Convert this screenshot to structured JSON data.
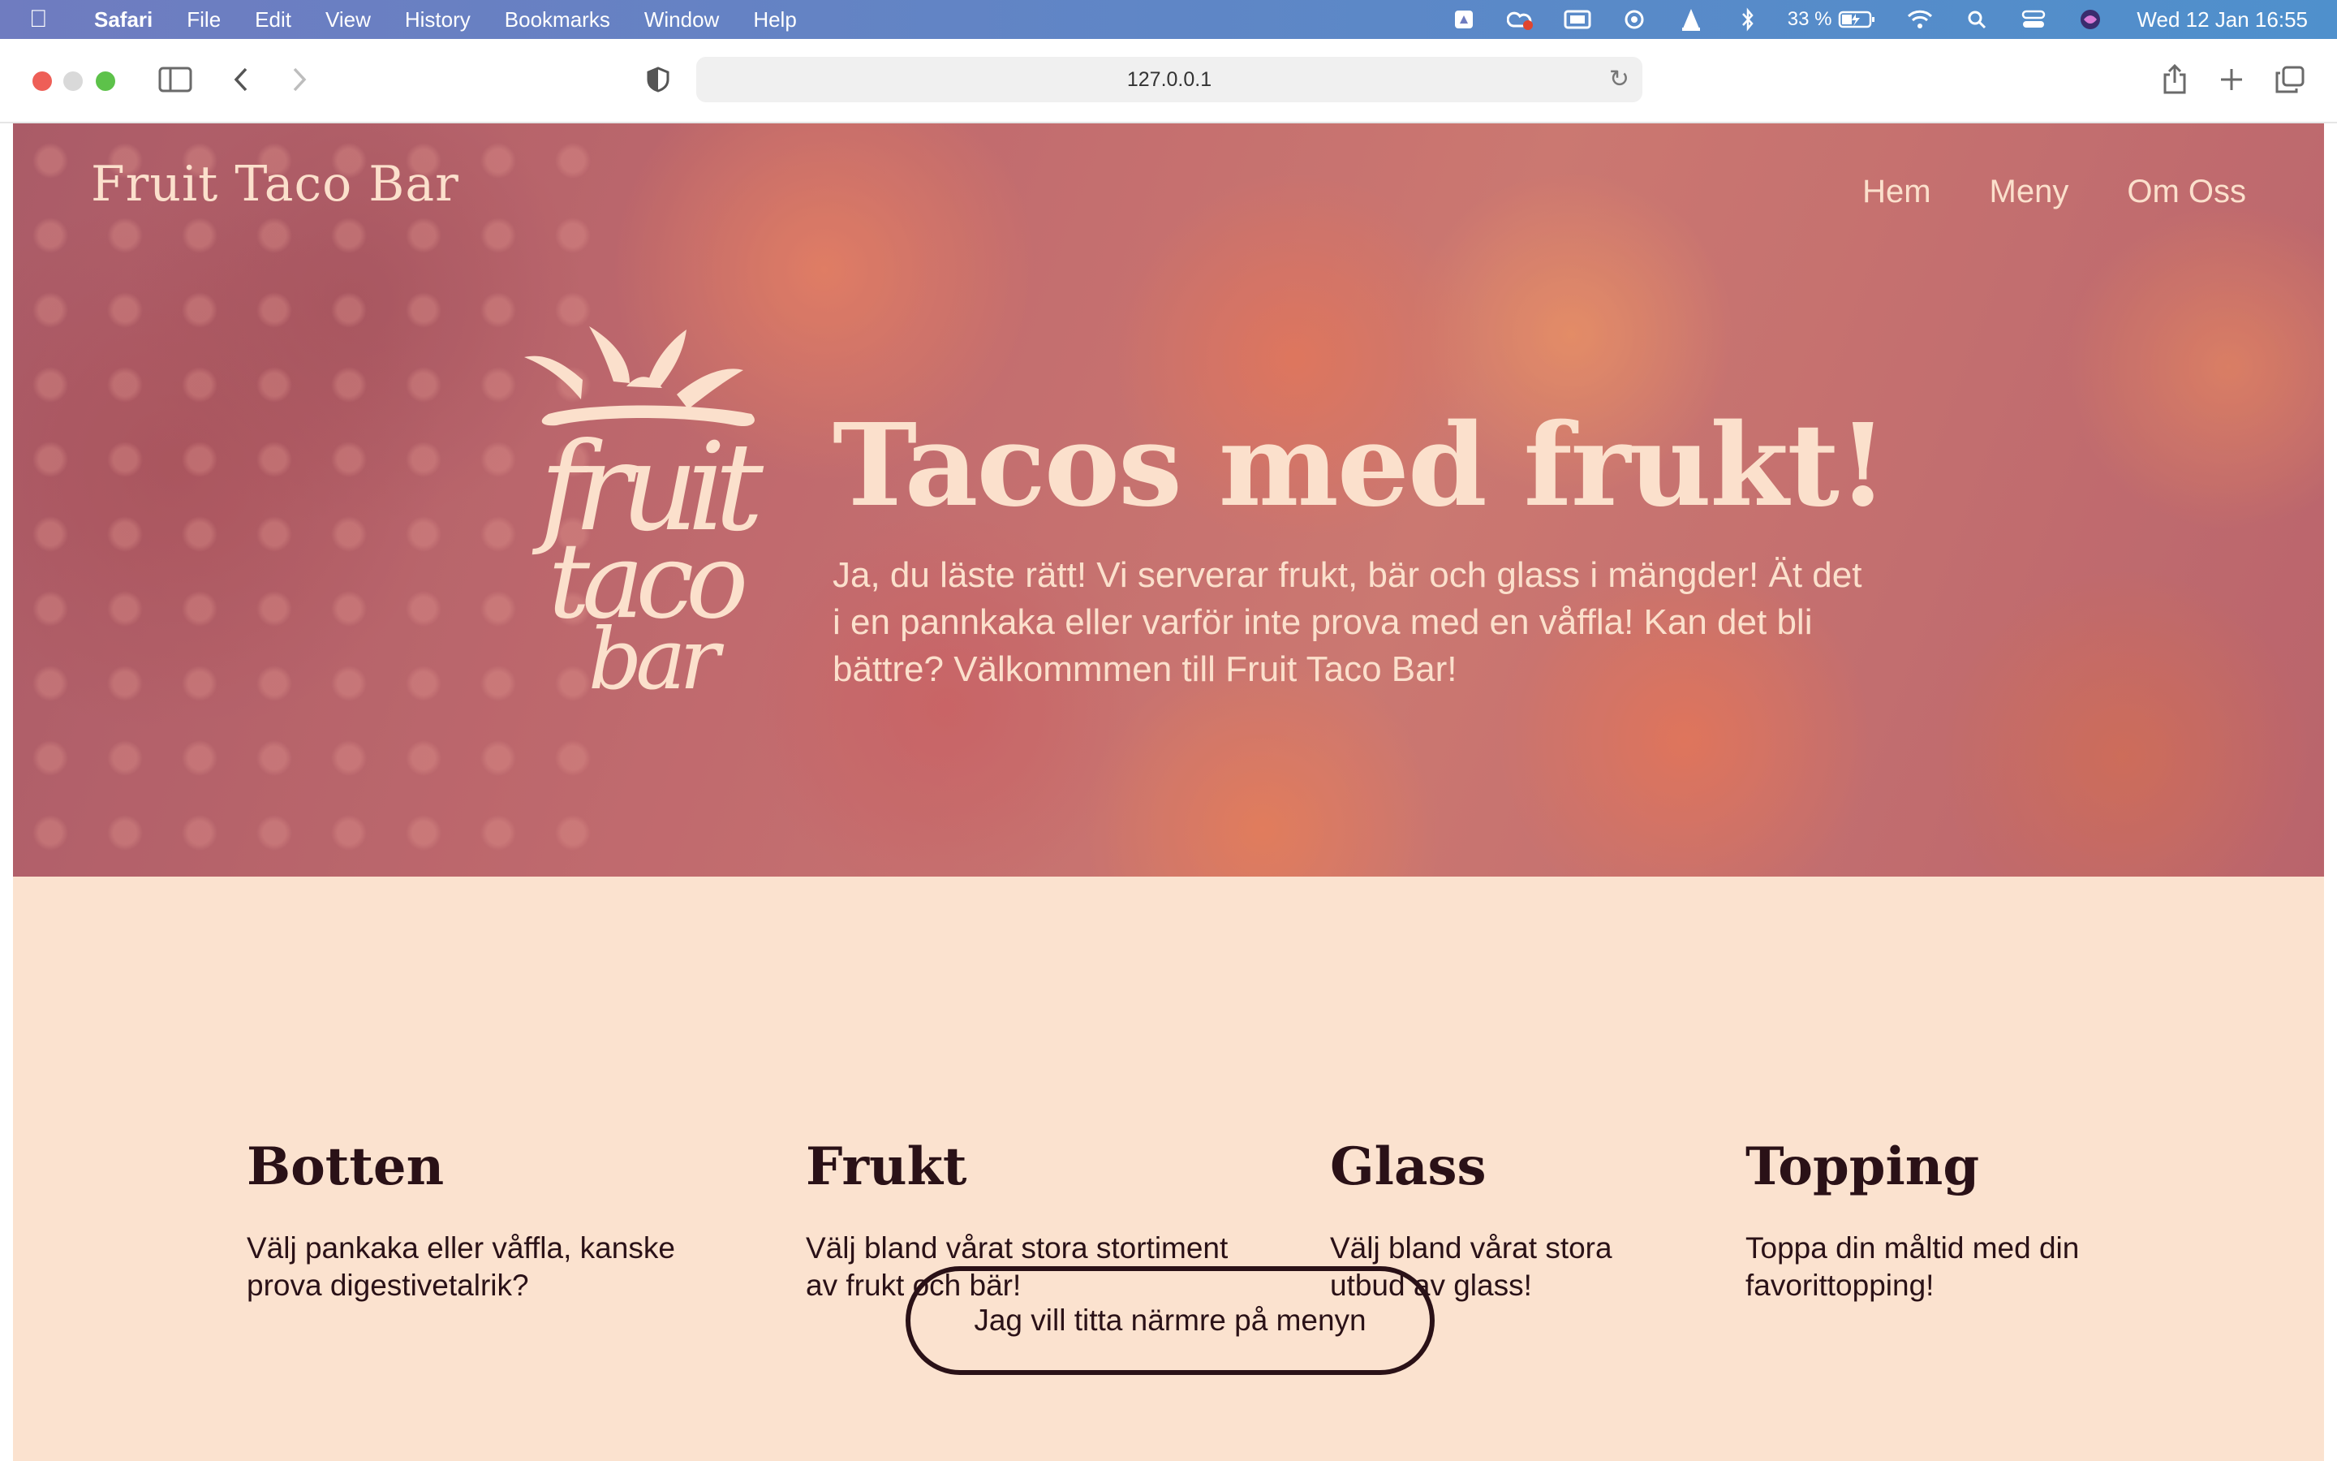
{
  "menubar": {
    "app_name": "Safari",
    "items": [
      "File",
      "Edit",
      "View",
      "History",
      "Bookmarks",
      "Window",
      "Help"
    ],
    "battery": "33 %",
    "clock": "Wed 12 Jan  16:55",
    "status_icons": [
      "drive-icon",
      "creative-cloud-icon",
      "display-icon",
      "sync-icon",
      "vlc-icon",
      "bluetooth-icon",
      "battery-icon",
      "wifi-icon",
      "search-icon",
      "control-center-icon",
      "siri-icon"
    ]
  },
  "browser": {
    "url": "127.0.0.1"
  },
  "site": {
    "title": "Fruit Taco Bar",
    "nav": [
      "Hem",
      "Meny",
      "Om Oss"
    ]
  },
  "logo": {
    "lines": [
      "fruit",
      "taco",
      "bar"
    ],
    "color": "#fbe0cc"
  },
  "hero": {
    "heading": "Tacos med frukt!",
    "text": "Ja, du läste rätt! Vi serverar frukt, bär och glass i mängder! Ät det i en pannkaka eller varför inte prova med en våffla! Kan det bli bättre? Välkommmen till Fruit Taco Bar!"
  },
  "features": [
    {
      "title": "Botten",
      "text": "Välj pankaka eller våffla, kanske prova digestivetalrik?"
    },
    {
      "title": "Frukt",
      "text": "Välj bland vårat stora stortiment av frukt och bär!"
    },
    {
      "title": "Glass",
      "text": "Välj bland vårat stora utbud av glass!"
    },
    {
      "title": "Topping",
      "text": "Toppa din måltid med din favorittopping!"
    }
  ],
  "cta": {
    "label": "Jag vill titta närmre på menyn"
  },
  "colors": {
    "cream": "#fbe0cc",
    "features_bg": "#fbe2cf",
    "dark_text": "#2a1117",
    "hero_base": "#c26a6e"
  }
}
